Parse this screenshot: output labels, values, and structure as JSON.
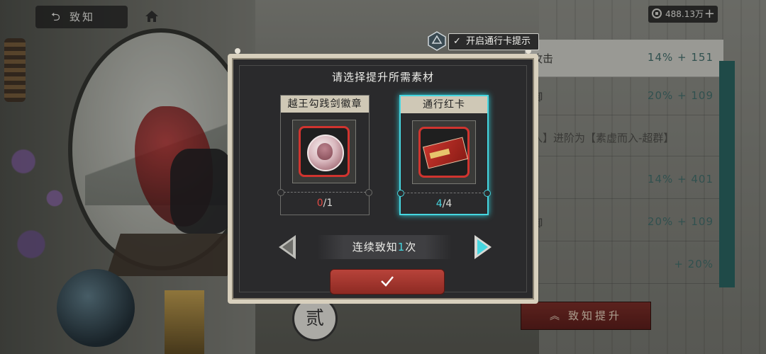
{
  "top_bar": {
    "back_label": "致知",
    "back_icon": "undo-arrow-icon",
    "home_icon": "home-icon",
    "currency_amount": "488.13万",
    "currency_plus": "+"
  },
  "pass_toggle": {
    "checked": true,
    "label": "开启通行卡提示"
  },
  "dialog": {
    "title": "请选择提升所需素材",
    "materials": [
      {
        "name": "越王勾践剑徽章",
        "have": "0",
        "sep": "/",
        "need": "1",
        "selected": false,
        "icon": "badge-medal-icon"
      },
      {
        "name": "通行红卡",
        "have": "4",
        "sep": "/",
        "need": "4",
        "selected": true,
        "icon": "red-pass-card-icon"
      }
    ],
    "continuous_prefix": "连续致知",
    "continuous_count": "1",
    "continuous_suffix": "次",
    "confirm_icon": "checkmark-icon"
  },
  "info_panel": {
    "rows": [
      {
        "label": "攻击",
        "value": "14% + 151"
      },
      {
        "label": "御",
        "value": "20% + 109"
      },
      {
        "label": "入】进阶为【素虚而入-超群】",
        "value": ""
      },
      {
        "label": "",
        "value": "14% + 401"
      },
      {
        "label": "御",
        "value": "20% + 109"
      },
      {
        "label": "",
        "value": "+ 20%"
      }
    ],
    "upgrade_label": "致知提升"
  },
  "background": {
    "seal_char": "贰"
  },
  "colors": {
    "accent_cyan": "#46d6e0",
    "confirm_red": "#a63a32",
    "have_red": "#e04a44"
  }
}
